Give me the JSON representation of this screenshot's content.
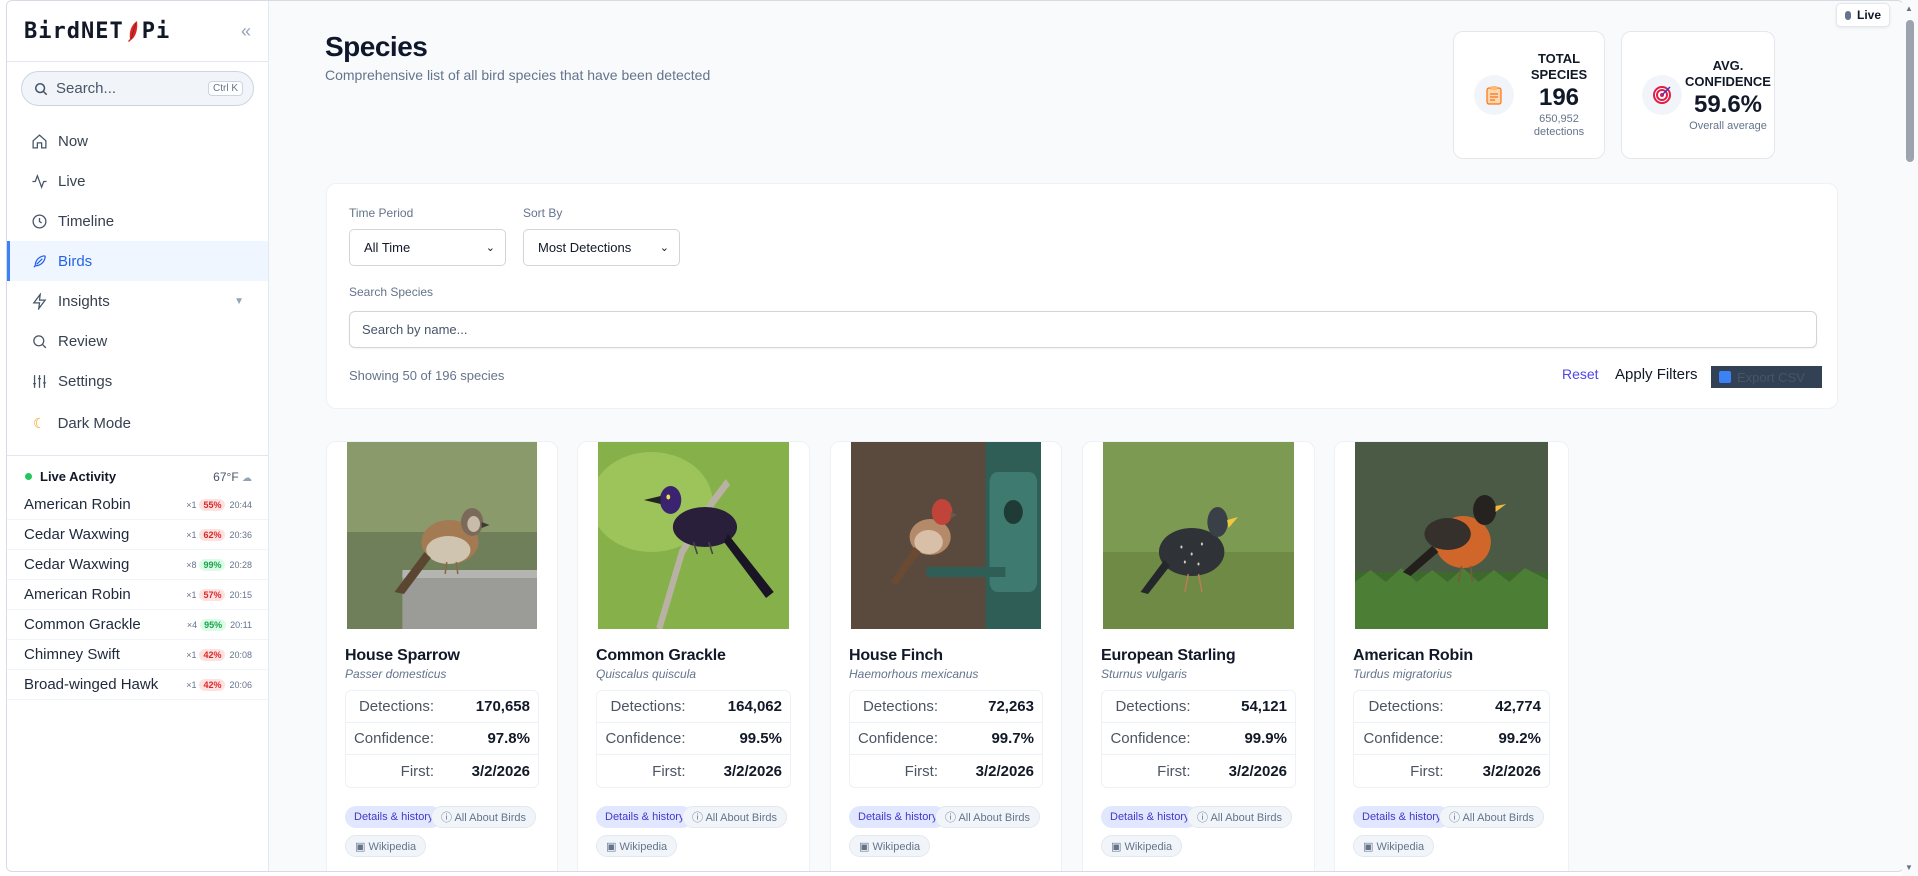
{
  "app": {
    "logo_text": "BirdNET",
    "logo_suffix": "Pi"
  },
  "sidebar": {
    "search_placeholder": "Search...",
    "search_shortcut": "Ctrl K",
    "nav": [
      {
        "label": "Now",
        "icon": "home-icon"
      },
      {
        "label": "Live",
        "icon": "activity-icon"
      },
      {
        "label": "Timeline",
        "icon": "clock-icon"
      },
      {
        "label": "Birds",
        "icon": "feather-icon",
        "active": true
      },
      {
        "label": "Insights",
        "icon": "zap-icon"
      },
      {
        "label": "Review",
        "icon": "search-icon"
      },
      {
        "label": "Settings",
        "icon": "sliders-icon"
      }
    ],
    "dark_mode": "Dark Mode",
    "live_activity": {
      "title": "Live Activity",
      "temperature": "67°F",
      "items": [
        {
          "name": "American Robin",
          "count": "×1",
          "conf": "55%",
          "time": "20:44"
        },
        {
          "name": "Cedar Waxwing",
          "count": "×1",
          "conf": "62%",
          "time": "20:36"
        },
        {
          "name": "Cedar Waxwing",
          "count": "×8",
          "conf": "99%",
          "time": "20:28"
        },
        {
          "name": "American Robin",
          "count": "×1",
          "conf": "57%",
          "time": "20:15"
        },
        {
          "name": "Common Grackle",
          "count": "×4",
          "conf": "95%",
          "time": "20:11"
        },
        {
          "name": "Chimney Swift",
          "count": "×1",
          "conf": "42%",
          "time": "20:08"
        },
        {
          "name": "Broad-winged Hawk",
          "count": "×1",
          "conf": "42%",
          "time": "20:06"
        }
      ]
    }
  },
  "header": {
    "title": "Species",
    "subtitle": "Comprehensive list of all bird species that have been detected",
    "live_label": "Live"
  },
  "stats": {
    "total": {
      "label_line1": "TOTAL",
      "label_line2": "SPECIES",
      "value": "196",
      "sub1": "650,952",
      "sub2": "detections"
    },
    "confidence": {
      "label_line1": "AVG.",
      "label_line2": "CONFIDENCE",
      "value": "59.6%",
      "sub1": "Overall average"
    }
  },
  "filters": {
    "time_period_label": "Time Period",
    "time_period_value": "All Time",
    "sort_by_label": "Sort By",
    "sort_by_value": "Most Detections",
    "search_label": "Search Species",
    "search_placeholder": "Search by name...",
    "showing": "Showing 50 of 196 species",
    "reset": "Reset",
    "apply": "Apply Filters",
    "export": "Export CSV"
  },
  "card_labels": {
    "detections": "Detections:",
    "confidence": "Confidence:",
    "first": "First:",
    "details": "Details & history",
    "aab": "ⓘ All About Birds",
    "wiki": "▣ Wikipedia"
  },
  "species": [
    {
      "name": "House Sparrow",
      "scientific": "Passer domesticus",
      "detections": "170,658",
      "confidence": "97.8%",
      "first": "3/2/2026"
    },
    {
      "name": "Common Grackle",
      "scientific": "Quiscalus quiscula",
      "detections": "164,062",
      "confidence": "99.5%",
      "first": "3/2/2026"
    },
    {
      "name": "House Finch",
      "scientific": "Haemorhous mexicanus",
      "detections": "72,263",
      "confidence": "99.7%",
      "first": "3/2/2026"
    },
    {
      "name": "European Starling",
      "scientific": "Sturnus vulgaris",
      "detections": "54,121",
      "confidence": "99.9%",
      "first": "3/2/2026"
    },
    {
      "name": "American Robin",
      "scientific": "Turdus migratorius",
      "detections": "42,774",
      "confidence": "99.2%",
      "first": "3/2/2026"
    }
  ],
  "colors": {
    "accent": "#2563eb",
    "link": "#4f46e5",
    "badge_red": "#dc2626",
    "badge_green": "#16a34a"
  }
}
